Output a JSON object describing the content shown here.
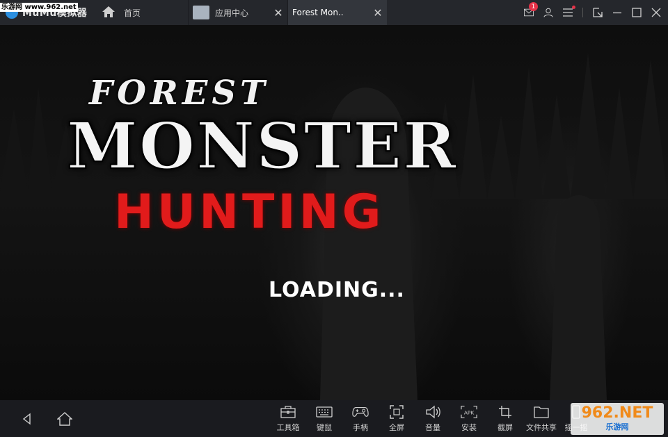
{
  "titlebar": {
    "brand_name": "MuMu模拟器",
    "watermark": "乐游网 www.962.net",
    "home_label": "首页",
    "tabs": [
      {
        "label": "应用中心",
        "icon": "app-center-icon",
        "active": false
      },
      {
        "label": "Forest Mon..",
        "icon": "game-thumbnail-icon",
        "active": true
      }
    ],
    "message_badge": "1"
  },
  "game": {
    "title_line1": "FOREST",
    "title_line2": "MONSTER",
    "title_line3": "HUNTING",
    "loading_text": "LOADING..."
  },
  "bottombar": {
    "tools": [
      {
        "label": "工具箱",
        "icon": "toolbox-icon"
      },
      {
        "label": "键鼠",
        "icon": "keyboard-icon"
      },
      {
        "label": "手柄",
        "icon": "gamepad-icon"
      },
      {
        "label": "全屏",
        "icon": "fullscreen-icon"
      },
      {
        "label": "音量",
        "icon": "volume-icon"
      },
      {
        "label": "安装",
        "icon": "apk-install-icon"
      },
      {
        "label": "截屏",
        "icon": "crop-icon"
      },
      {
        "label": "文件共享",
        "icon": "folder-icon"
      },
      {
        "label": "摇一摇",
        "icon": "shake-icon"
      }
    ],
    "watermark_main": "962.NET",
    "watermark_sub": "乐游网"
  },
  "colors": {
    "titlebar_bg": "#25272c",
    "active_tab_bg": "#33363c",
    "bottombar_bg": "#1a1b1f",
    "hunting_red": "#e11b1b",
    "badge_red": "#e53248"
  }
}
